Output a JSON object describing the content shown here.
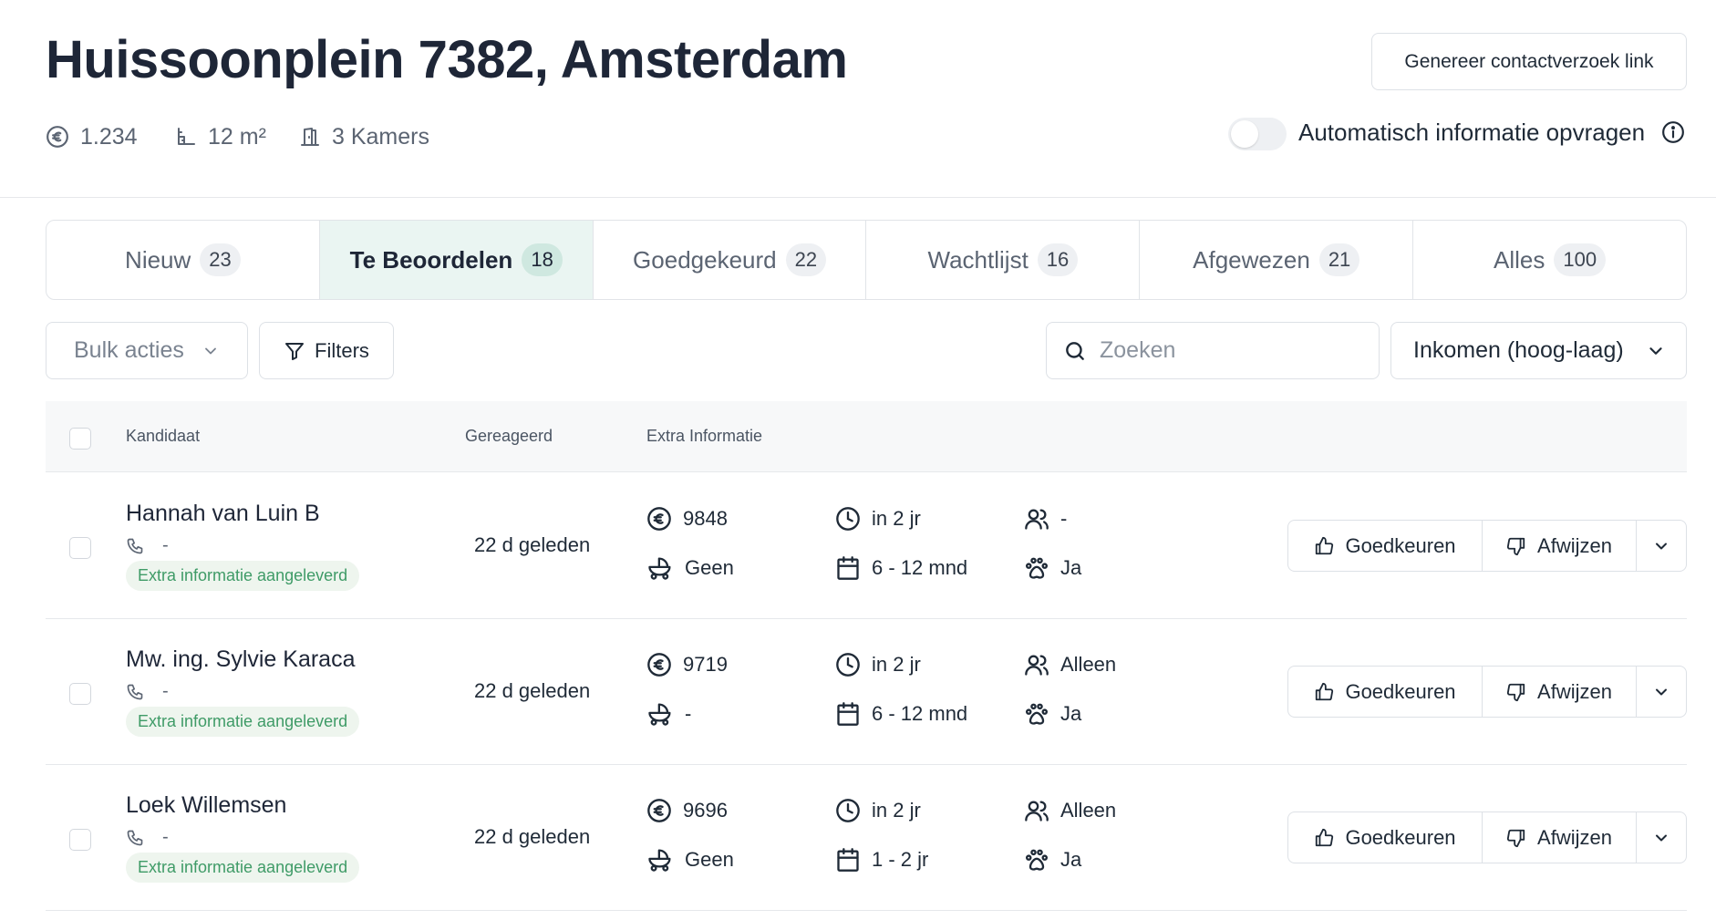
{
  "header": {
    "title": "Huissoonplein 7382, Amsterdam",
    "price": "1.234",
    "area": "12 m²",
    "rooms": "3 Kamers",
    "contact_link_button": "Genereer contactverzoek link",
    "auto_info_label": "Automatisch informatie opvragen",
    "auto_info_enabled": false
  },
  "tabs": [
    {
      "label": "Nieuw",
      "count": "23",
      "active": false
    },
    {
      "label": "Te Beoordelen",
      "count": "18",
      "active": true
    },
    {
      "label": "Goedgekeurd",
      "count": "22",
      "active": false
    },
    {
      "label": "Wachtlijst",
      "count": "16",
      "active": false
    },
    {
      "label": "Afgewezen",
      "count": "21",
      "active": false
    },
    {
      "label": "Alles",
      "count": "100",
      "active": false
    }
  ],
  "toolbar": {
    "bulk_label": "Bulk acties",
    "filters_label": "Filters",
    "search_placeholder": "Zoeken",
    "sort_label": "Inkomen (hoog-laag)"
  },
  "table": {
    "columns": {
      "candidate": "Kandidaat",
      "reacted": "Gereageerd",
      "extra": "Extra Informatie"
    },
    "approve_label": "Goedkeuren",
    "reject_label": "Afwijzen",
    "rows": [
      {
        "name": "Hannah van Luin B",
        "phone": "-",
        "badge": "Extra informatie aangeleverd",
        "reacted": "22 d geleden",
        "income": "9848",
        "start": "in 2 jr",
        "household": "-",
        "children": "Geen",
        "duration": "6 - 12 mnd",
        "pets": "Ja"
      },
      {
        "name": "Mw. ing. Sylvie Karaca",
        "phone": "-",
        "badge": "Extra informatie aangeleverd",
        "reacted": "22 d geleden",
        "income": "9719",
        "start": "in 2 jr",
        "household": "Alleen",
        "children": "-",
        "duration": "6 - 12 mnd",
        "pets": "Ja"
      },
      {
        "name": "Loek Willemsen",
        "phone": "-",
        "badge": "Extra informatie aangeleverd",
        "reacted": "22 d geleden",
        "income": "9696",
        "start": "in 2 jr",
        "household": "Alleen",
        "children": "Geen",
        "duration": "1 - 2 jr",
        "pets": "Ja"
      }
    ]
  }
}
